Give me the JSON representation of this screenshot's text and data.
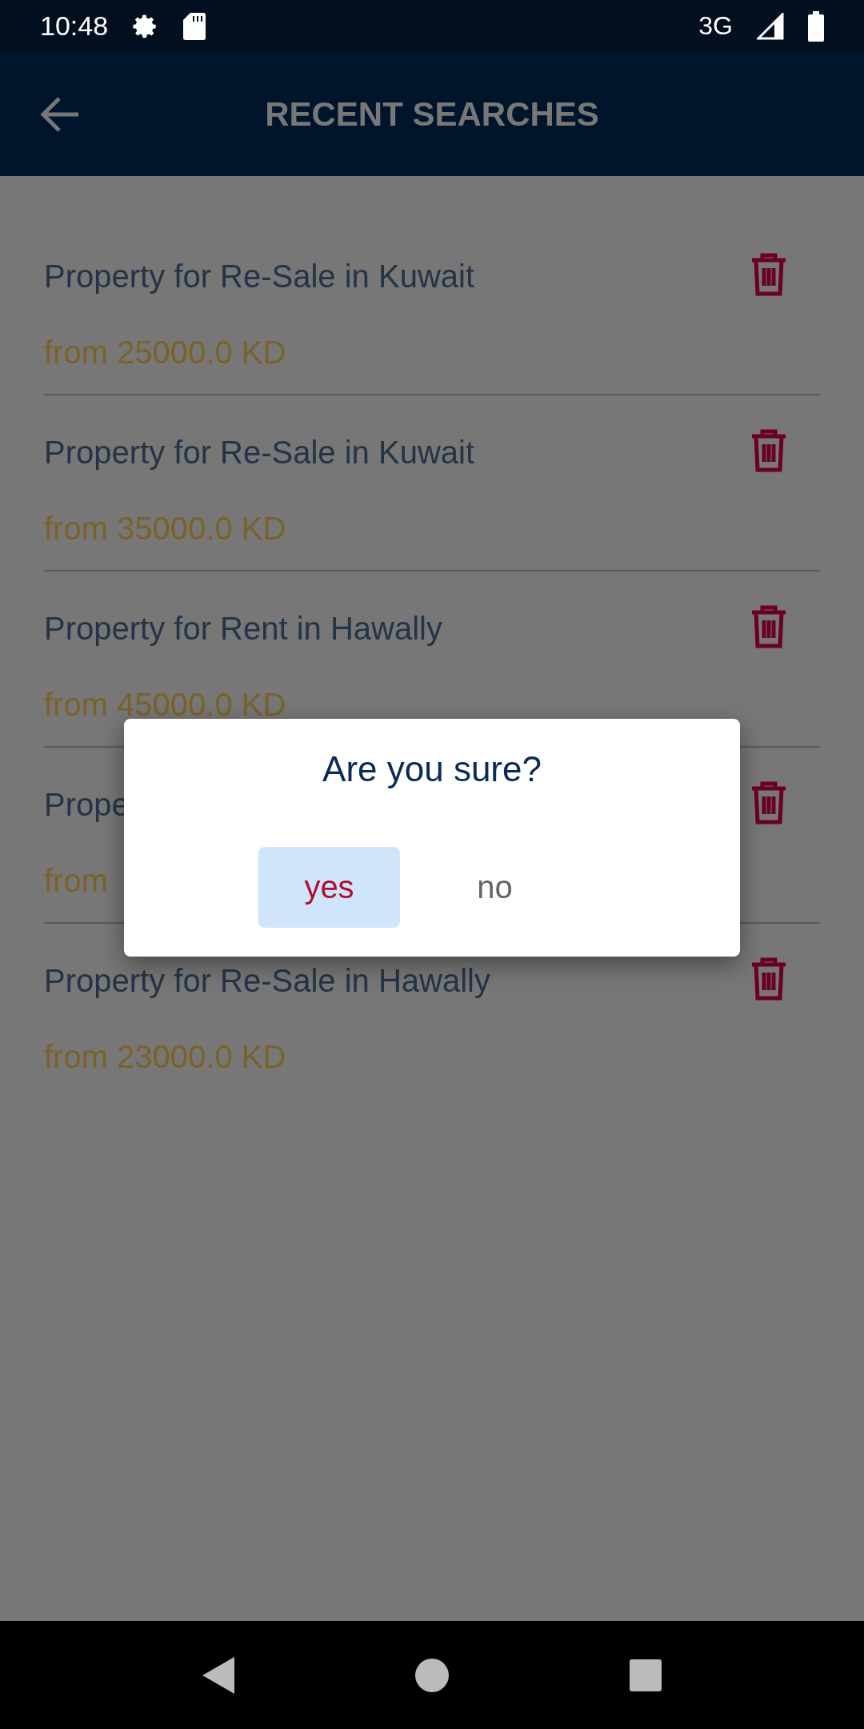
{
  "status_bar": {
    "time": "10:48",
    "network": "3G"
  },
  "app_bar": {
    "title": "RECENT SEARCHES"
  },
  "searches": [
    {
      "title": "Property for Re-Sale in Kuwait",
      "price": "from 25000.0 KD"
    },
    {
      "title": "Property for Re-Sale in Kuwait",
      "price": "from 35000.0 KD"
    },
    {
      "title": "Property for Rent in Hawally",
      "price": "from 45000.0 KD"
    },
    {
      "title": "Prope",
      "price": "from"
    },
    {
      "title": "Property for Re-Sale in Hawally",
      "price": "from 23000.0 KD"
    }
  ],
  "dialog": {
    "title": "Are you sure?",
    "buttons": [
      {
        "label": "yes",
        "selected": true
      },
      {
        "label": "no",
        "selected": false
      }
    ]
  }
}
